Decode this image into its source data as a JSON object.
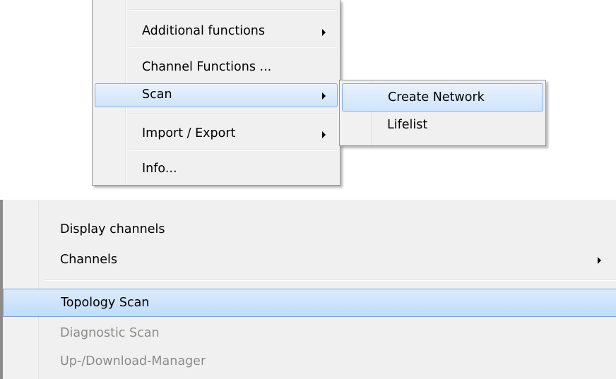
{
  "top_menu": {
    "items": [
      {
        "label": "Additional functions",
        "has_submenu": true
      },
      {
        "label": "Channel Functions ...",
        "has_submenu": false
      },
      {
        "label": "Scan",
        "has_submenu": true,
        "highlighted": true
      },
      {
        "label": "Import / Export",
        "has_submenu": true
      },
      {
        "label": "Info...",
        "has_submenu": false
      }
    ]
  },
  "scan_submenu": {
    "items": [
      {
        "label": "Create Network",
        "highlighted": true
      },
      {
        "label": "Lifelist"
      }
    ]
  },
  "bottom_menu": {
    "items": [
      {
        "label": "Display channels",
        "has_submenu": false
      },
      {
        "label": "Channels",
        "has_submenu": true
      },
      {
        "label": "Topology Scan",
        "highlighted": true
      },
      {
        "label": "Diagnostic Scan",
        "disabled": true
      },
      {
        "label": "Up-/Download-Manager",
        "disabled": true
      }
    ]
  },
  "colors": {
    "menu_bg": "#f0f0f0",
    "highlight_top": "#e8f2fd",
    "highlight_bottom": "#cfe4fb",
    "highlight_border": "#84acdd",
    "disabled_text": "#8b8b8b"
  }
}
